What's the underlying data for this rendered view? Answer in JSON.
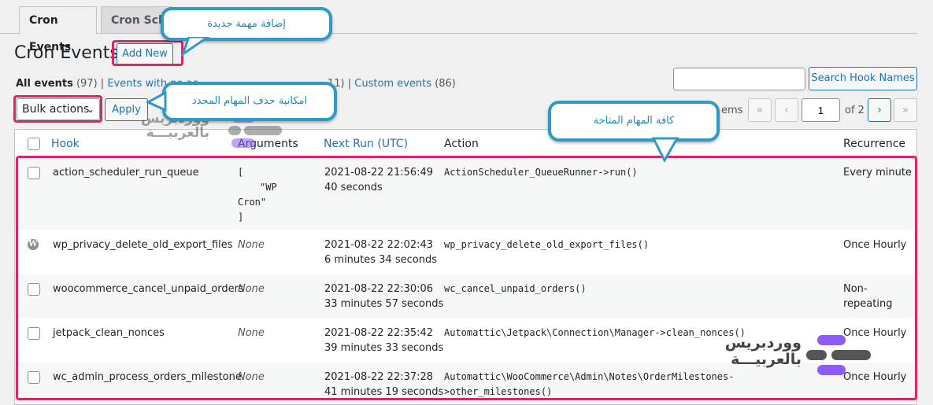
{
  "tabs": [
    {
      "label": "Cron Events"
    },
    {
      "label": "Cron Sche"
    }
  ],
  "page_title": "Cron Events",
  "add_new_label": "Add New",
  "filters": {
    "all": "All events",
    "all_count": "(97)",
    "no_action": "Events with no ac",
    "sep": "|",
    "partial_count": "11)",
    "custom": "Custom events",
    "custom_count": "(86)"
  },
  "search": {
    "value": "",
    "button_label": "Search Hook Names"
  },
  "bulk": {
    "selected": "Bulk actions",
    "apply_label": "Apply"
  },
  "pagination": {
    "items_label": "ems",
    "first": "«",
    "prev": "‹",
    "page": "1",
    "of": "of 2",
    "next": "›",
    "last": "»"
  },
  "table": {
    "headers": {
      "hook": "Hook",
      "arguments": "Arguments",
      "next_run": "Next Run (UTC)",
      "action": "Action",
      "recurrence": "Recurrence"
    },
    "rows": [
      {
        "hook": "action_scheduler_run_queue",
        "args_lines": [
          "[",
          "\"WP",
          "Cron\"",
          "]"
        ],
        "next_run": "2021-08-22 21:56:49",
        "next_rel": "40 seconds",
        "action": [
          "ActionScheduler_QueueRunner->run()"
        ],
        "recurrence": [
          "Every minute"
        ]
      },
      {
        "hook": "wp_privacy_delete_old_export_files",
        "args": "None",
        "next_run": "2021-08-22 22:02:43",
        "next_rel": "6 minutes 34 seconds",
        "action": [
          "wp_privacy_delete_old_export_files()"
        ],
        "recurrence": [
          "Once Hourly"
        ]
      },
      {
        "hook": "woocommerce_cancel_unpaid_orders",
        "args": "None",
        "next_run": "2021-08-22 22:30:06",
        "next_rel": "33 minutes 57 seconds",
        "action": [
          "wc_cancel_unpaid_orders()"
        ],
        "recurrence": [
          "Non-",
          "repeating"
        ]
      },
      {
        "hook": "jetpack_clean_nonces",
        "args": "None",
        "next_run": "2021-08-22 22:35:42",
        "next_rel": "39 minutes 33 seconds",
        "action": [
          "Automattic\\Jetpack\\Connection\\Manager->clean_nonces()"
        ],
        "recurrence": [
          "Once Hourly"
        ]
      },
      {
        "hook": "wc_admin_process_orders_milestone",
        "args": "None",
        "next_run": "2021-08-22 22:37:28",
        "next_rel": "41 minutes 19 seconds",
        "action": [
          "Automattic\\WooCommerce\\Admin\\Notes\\OrderMilestones-",
          ">other_milestones()"
        ],
        "recurrence": [
          "Once Hourly"
        ]
      }
    ]
  },
  "annotations": {
    "add_task": "إضافة مهمة جديدة",
    "delete_selected": "امكانية حذف المهام المحدد",
    "all_tasks": "كافة المهام المتاحة"
  },
  "watermark": {
    "line1": "ووردبريس",
    "line2": "بالعربيـــة"
  },
  "colors": {
    "accent": "#2271b1",
    "highlight": "#e0245e",
    "bubble_border": "#2f9ac6",
    "logo_purple": "#8b5cf6"
  }
}
